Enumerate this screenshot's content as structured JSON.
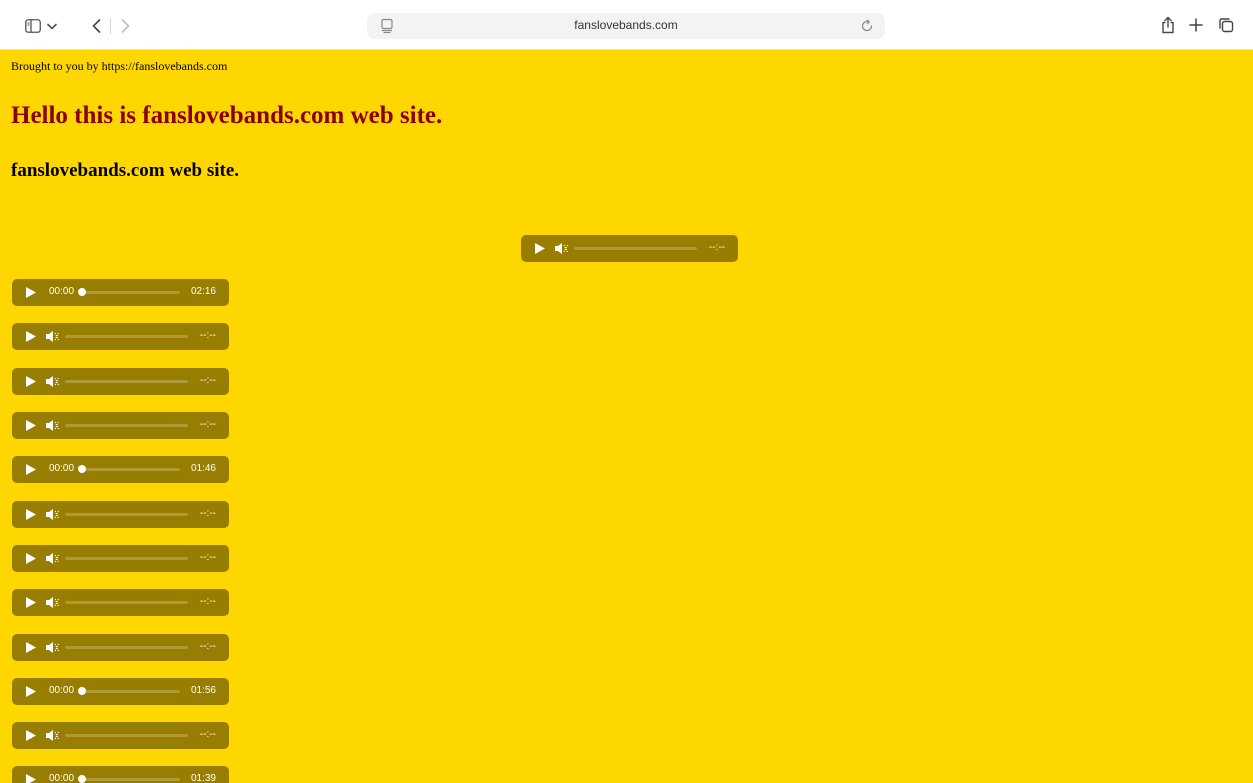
{
  "browser": {
    "url": "fanslovebands.com"
  },
  "page": {
    "credit": "Brought to you by https://fanslovebands.com",
    "headline": "Hello this is fanslovebands.com web site.",
    "subhead": "fanslovebands.com web site."
  },
  "featured_player": {
    "state": "pending",
    "duration": "--:--"
  },
  "players": [
    {
      "state": "loaded",
      "current": "00:00",
      "duration": "02:16"
    },
    {
      "state": "pending",
      "duration": "--:--"
    },
    {
      "state": "pending",
      "duration": "--:--"
    },
    {
      "state": "pending",
      "duration": "--:--"
    },
    {
      "state": "loaded",
      "current": "00:00",
      "duration": "01:46"
    },
    {
      "state": "pending",
      "duration": "--:--"
    },
    {
      "state": "pending",
      "duration": "--:--"
    },
    {
      "state": "pending",
      "duration": "--:--"
    },
    {
      "state": "pending",
      "duration": "--:--"
    },
    {
      "state": "loaded",
      "current": "00:00",
      "duration": "01:56"
    },
    {
      "state": "pending",
      "duration": "--:--"
    },
    {
      "state": "loaded",
      "current": "00:00",
      "duration": "01:39"
    }
  ],
  "colors": {
    "page_background": "#FFD700",
    "headline": "#8B0000",
    "player_background": "#987E00"
  },
  "icons": {
    "sidebar": "sidebar-icon",
    "back": "chevron-left-icon",
    "forward": "chevron-right-icon",
    "reader": "reader-icon",
    "reload": "reload-icon",
    "share": "share-icon",
    "new_tab": "plus-icon",
    "tabs": "tab-overview-icon",
    "play": "play-icon",
    "mute": "volume-icon"
  }
}
